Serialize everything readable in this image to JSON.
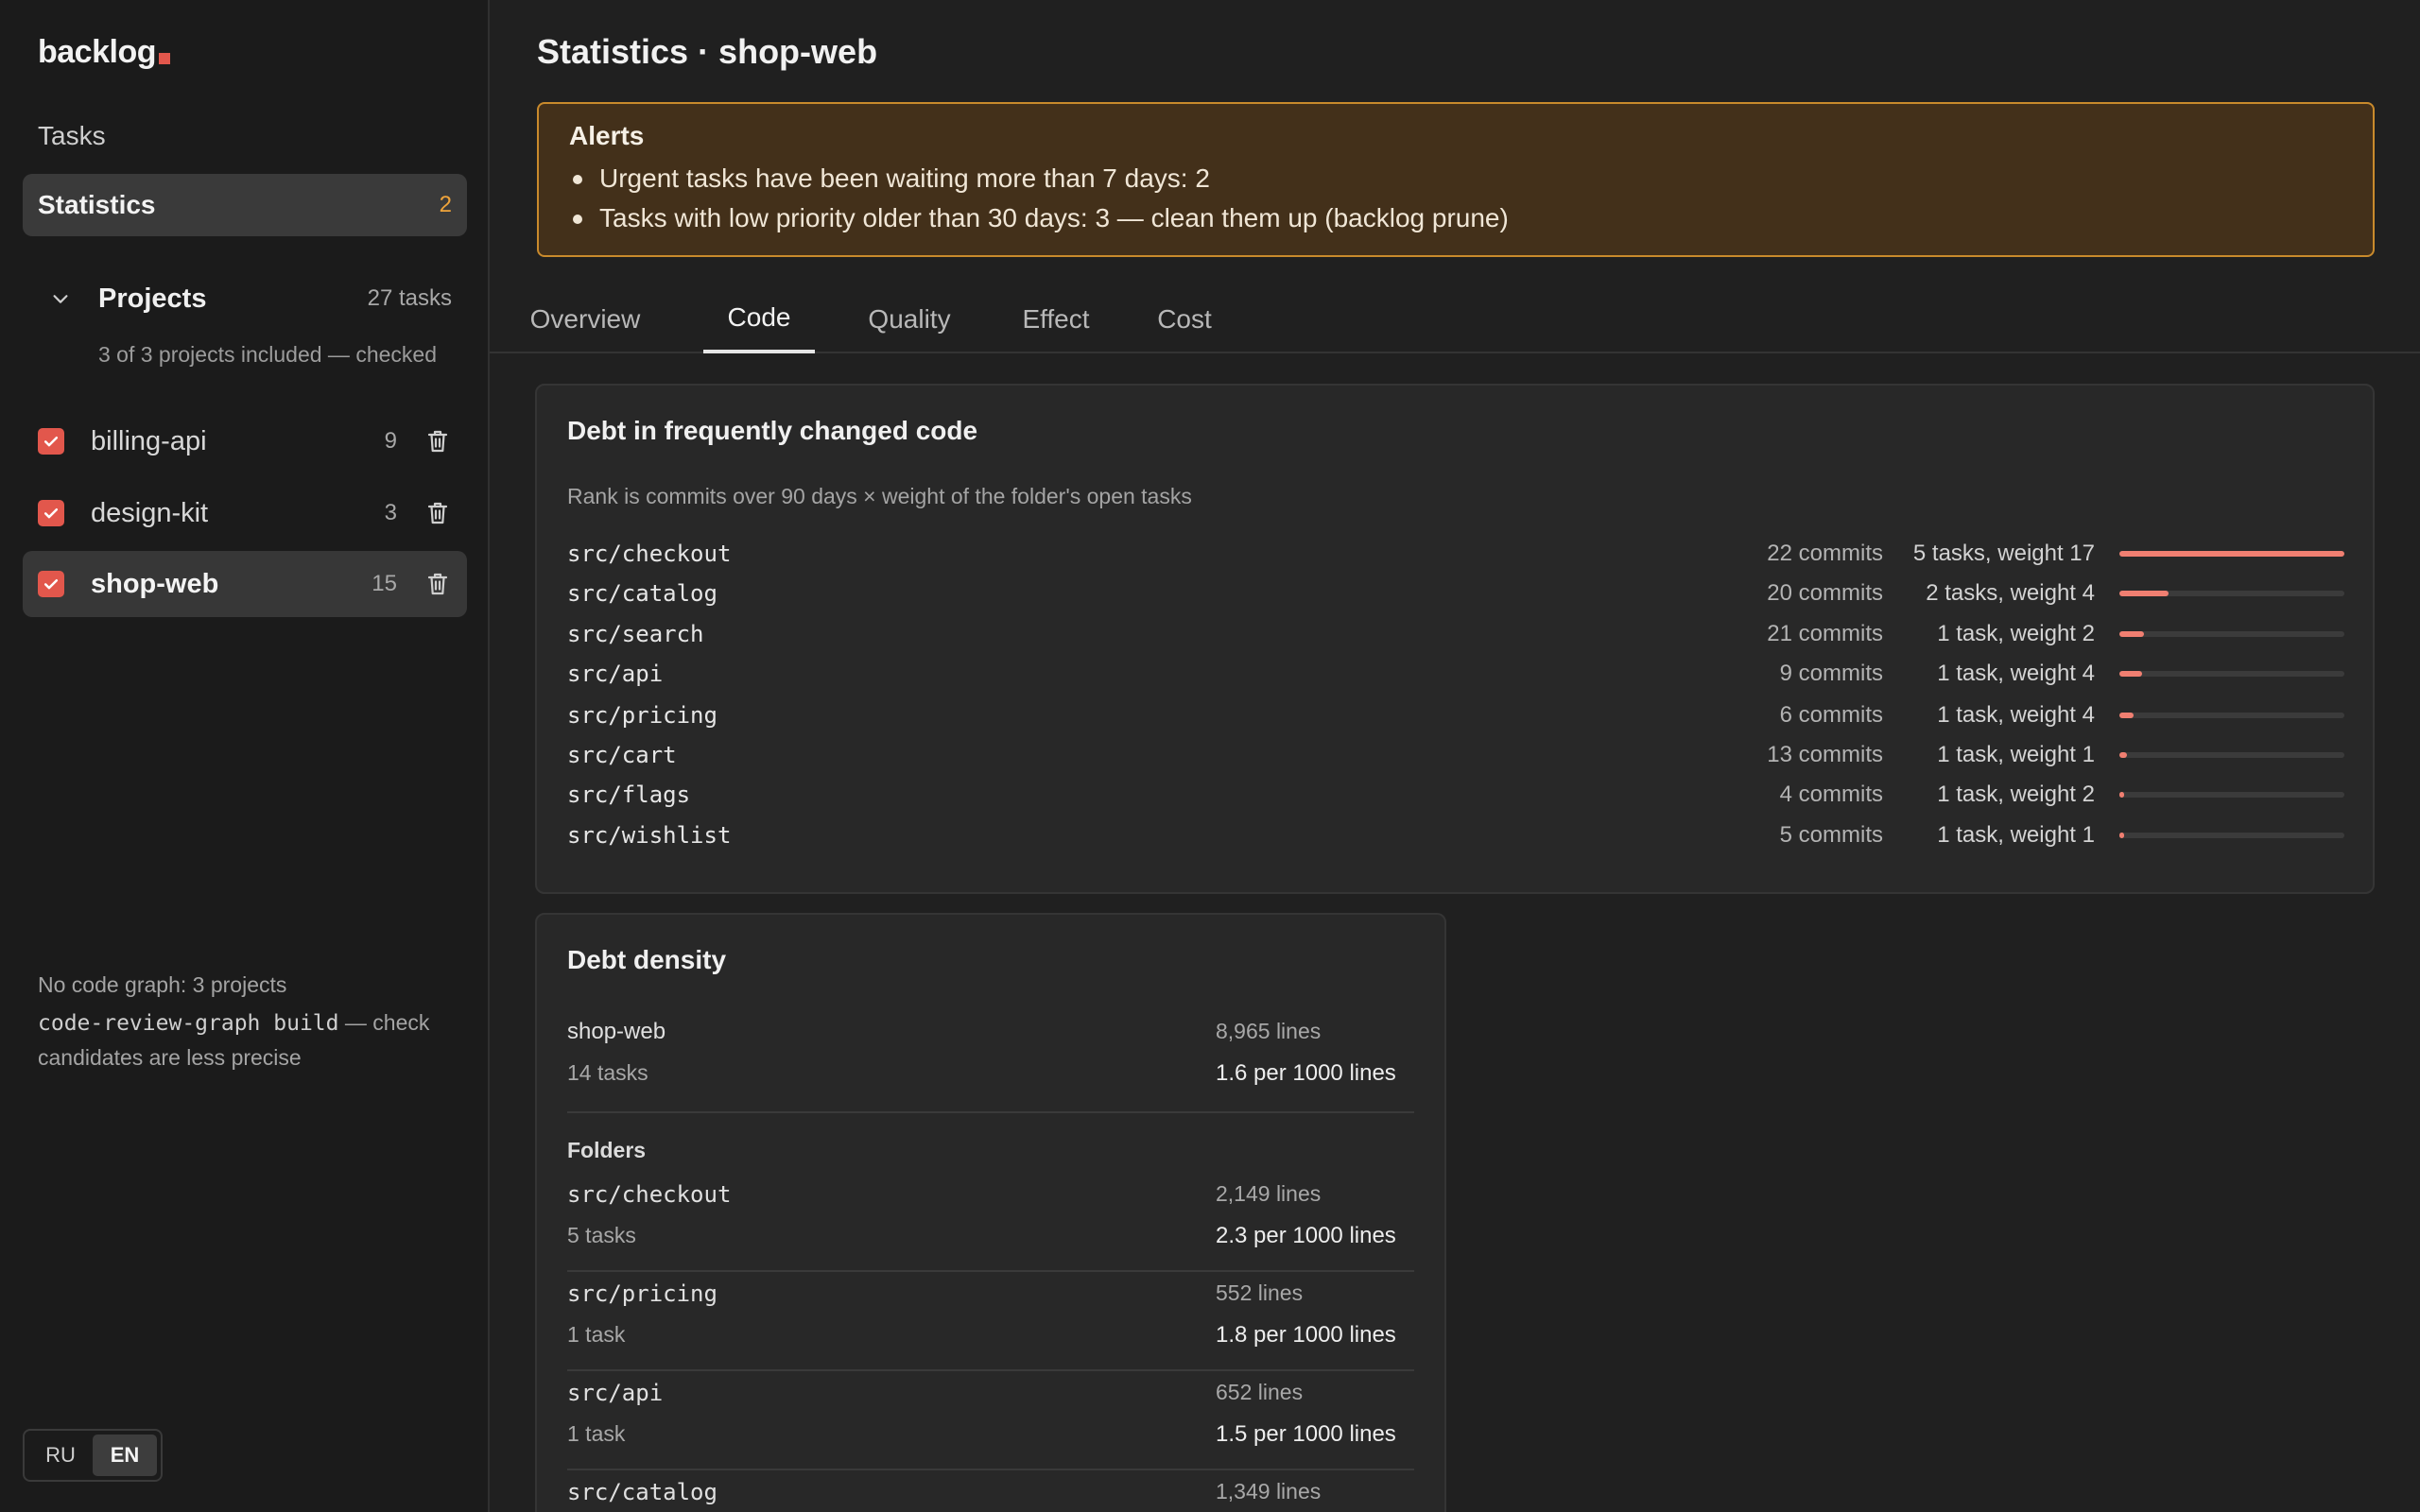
{
  "app": {
    "logo": "backlog"
  },
  "sidebar": {
    "nav": {
      "tasks": "Tasks",
      "statistics": "Statistics",
      "statistics_badge": "2"
    },
    "projects": {
      "title": "Projects",
      "count": "27 tasks",
      "note": "3 of 3 projects included — checked",
      "items": [
        {
          "name": "billing-api",
          "count": "9",
          "checked": true
        },
        {
          "name": "design-kit",
          "count": "3",
          "checked": true
        },
        {
          "name": "shop-web",
          "count": "15",
          "checked": true
        }
      ]
    },
    "graph_note": {
      "line1": "No code graph: 3 projects",
      "cmd": "code-review-graph build",
      "rest": " — check candidates are less precise"
    },
    "lang": {
      "ru": "RU",
      "en": "EN"
    }
  },
  "main": {
    "title": "Statistics · shop-web",
    "alerts": {
      "title": "Alerts",
      "items": [
        "Urgent tasks have been waiting more than 7 days: 2",
        "Tasks with low priority older than 30 days: 3 — clean them up (backlog prune)"
      ]
    },
    "tabs": [
      "Overview",
      "Code",
      "Quality",
      "Effect",
      "Cost"
    ],
    "active_tab": "Code",
    "hotspots": {
      "title": "Debt in frequently changed code",
      "subtitle": "Rank is commits over 90 days × weight of the folder's open tasks",
      "rows": [
        {
          "path": "src/checkout",
          "commits": "22 commits",
          "weight": "5 tasks, weight 17",
          "level": 1.0
        },
        {
          "path": "src/catalog",
          "commits": "20 commits",
          "weight": "2 tasks, weight 4",
          "level": 0.22
        },
        {
          "path": "src/search",
          "commits": "21 commits",
          "weight": "1 task, weight 2",
          "level": 0.11
        },
        {
          "path": "src/api",
          "commits": "9 commits",
          "weight": "1 task, weight 4",
          "level": 0.1
        },
        {
          "path": "src/pricing",
          "commits": "6 commits",
          "weight": "1 task, weight 4",
          "level": 0.065
        },
        {
          "path": "src/cart",
          "commits": "13 commits",
          "weight": "1 task, weight 1",
          "level": 0.035
        },
        {
          "path": "src/flags",
          "commits": "4 commits",
          "weight": "1 task, weight 2",
          "level": 0.02
        },
        {
          "path": "src/wishlist",
          "commits": "5 commits",
          "weight": "1 task, weight 1",
          "level": 0.013
        }
      ]
    },
    "density": {
      "title": "Debt density",
      "project": {
        "name": "shop-web",
        "lines": "8,965 lines",
        "tasks": "14 tasks",
        "per": "1.6 per 1000 lines"
      },
      "folders_title": "Folders",
      "folders": [
        {
          "path": "src/checkout",
          "lines": "2,149 lines",
          "tasks": "5 tasks",
          "per": "2.3 per 1000 lines"
        },
        {
          "path": "src/pricing",
          "lines": "552 lines",
          "tasks": "1 task",
          "per": "1.8 per 1000 lines"
        },
        {
          "path": "src/api",
          "lines": "652 lines",
          "tasks": "1 task",
          "per": "1.5 per 1000 lines"
        },
        {
          "path": "src/catalog",
          "lines": "1,349 lines",
          "tasks": "",
          "per": ""
        }
      ]
    }
  },
  "colors": {
    "accent": "#e2574c",
    "bar_fill": "#f07f71",
    "alert_bg": "#43301a",
    "alert_border": "#c98a2c",
    "badge": "#f0a43a"
  }
}
